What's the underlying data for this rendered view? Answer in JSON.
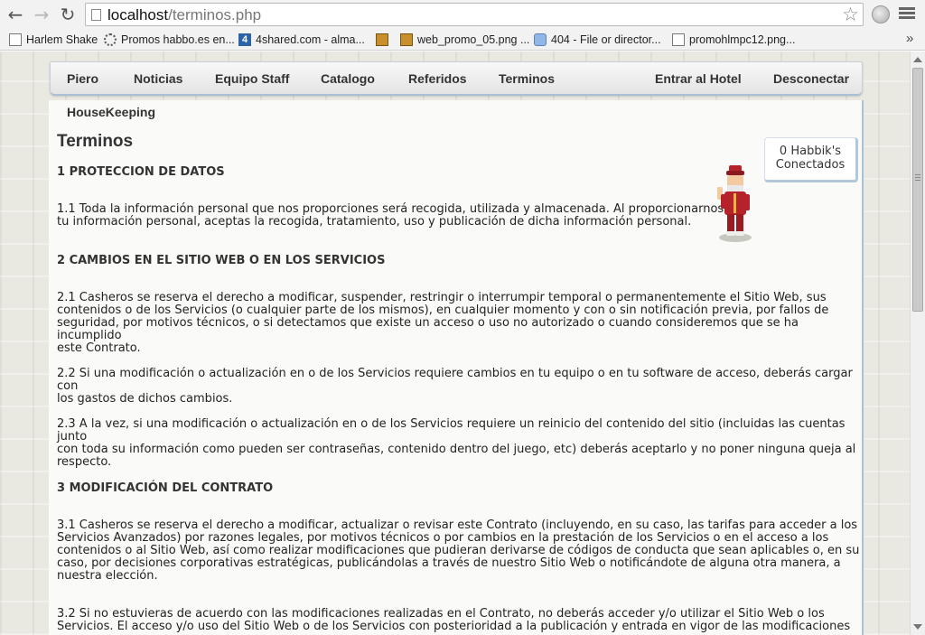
{
  "browser": {
    "url_host": "localhost",
    "url_path": "/terminos.php",
    "bookmarks": [
      {
        "label": "Harlem Shake",
        "icon": "doc-icon"
      },
      {
        "label": "Promos habbo.es en...",
        "icon": "gear-icon"
      },
      {
        "label": "4shared.com - alma...",
        "icon": "4shared-icon"
      },
      {
        "label": "",
        "icon": "box-icon"
      },
      {
        "label": "web_promo_05.png ...",
        "icon": "box-icon"
      },
      {
        "label": "404 - File or director...",
        "icon": "cloud-icon"
      },
      {
        "label": "promohlmpc12.png...",
        "icon": "doc-icon"
      }
    ],
    "more_label": "»"
  },
  "navbar": {
    "items": [
      "Piero",
      "Noticias",
      "Equipo Staff",
      "Catalogo",
      "Referidos",
      "Terminos",
      "Entrar al Hotel",
      "Desconectar"
    ],
    "second_row": "HouseKeeping"
  },
  "online": {
    "line1": "0 Habbik's",
    "line2": "Conectados"
  },
  "content": {
    "title": "Terminos",
    "blocks": [
      {
        "type": "heading",
        "text": "1 PROTECCION DE DATOS"
      },
      {
        "type": "text",
        "lines": [
          "1.1 Toda la información personal que nos proporciones será recogida, utilizada y almacenada. Al proporcionarnos",
          "tu información personal, aceptas la recogida, tratamiento, uso y publicación de dicha información personal."
        ]
      },
      {
        "type": "heading",
        "text": "2 CAMBIOS EN EL SITIO WEB O EN LOS SERVICIOS"
      },
      {
        "type": "text",
        "lines": [
          "2.1 Casheros se reserva el derecho a modificar, suspender, restringir o interrumpir temporal o permanentemente el Sitio Web, sus",
          "contenidos o de los Servicios (o cualquier parte de los mismos), en cualquier momento y con o sin notificación previa, por fallos de",
          "seguridad, por motivos técnicos, o si detectamos que existe un acceso o uso no autorizado o cuando consideremos que se ha incumplido",
          "este Contrato."
        ]
      },
      {
        "type": "text",
        "lines": [
          "2.2 Si una modificación o actualización en o de los Servicios requiere cambios en tu equipo o en tu software de acceso, deberás cargar con",
          "los gastos de dichos cambios."
        ]
      },
      {
        "type": "text",
        "lines": [
          "2.3 A la vez, si una modificación o actualización en o de los Servicios requiere un reinicio del contenido del sitio (incluidas las cuentas junto",
          "con toda su información como pueden ser contraseñas, contenido dentro del juego, etc) deberás aceptarlo y no poner ninguna queja al",
          "respecto."
        ]
      },
      {
        "type": "heading",
        "text": "3 MODIFICACIÓN DEL CONTRATO"
      },
      {
        "type": "text",
        "lines": [
          "3.1 Casheros se reserva el derecho a modificar, actualizar o revisar este Contrato (incluyendo, en su caso, las tarifas para acceder a los",
          "Servicios Avanzados) por razones legales, por motivos técnicos o por cambios en la prestación de los Servicios o en el acceso a los",
          "contenidos o al Sitio Web, así como realizar modificaciones que pudieran derivarse de códigos de conducta que sean aplicables o, en su",
          "caso, por decisiones corporativas estratégicas, publicándolas a través de nuestro Sitio Web o notificándote de alguna otra manera, a",
          "nuestra elección."
        ]
      },
      {
        "type": "text",
        "lines": [
          "3.2 Si no estuvieras de acuerdo con las modificaciones realizadas en el Contrato, no deberás acceder y/o utilizar el Sitio Web o los",
          "Servicios. El acceso y/o uso del Sitio Web o de los Servicios con posterioridad a la publicación y entrada en vigor de las modificaciones"
        ]
      }
    ]
  }
}
